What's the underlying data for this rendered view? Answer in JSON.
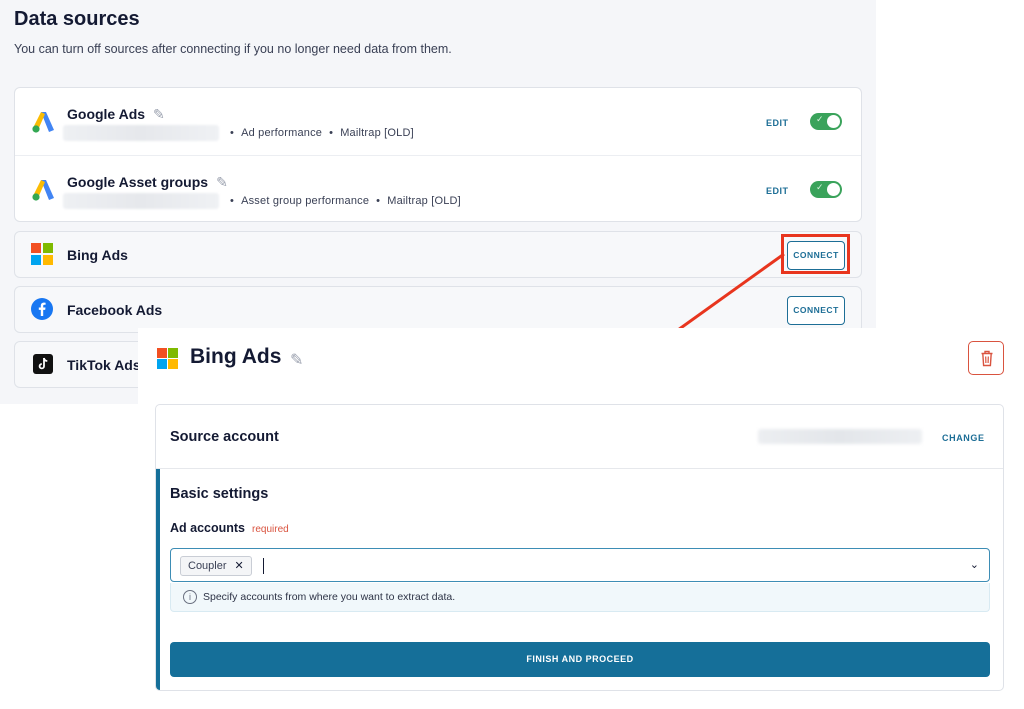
{
  "page": {
    "title": "Data sources",
    "subtitle": "You can turn off sources after connecting if you no longer need data from them."
  },
  "connected_sources": [
    {
      "name": "Google Ads",
      "icon": "google-ads-icon",
      "meta_report": "Ad performance",
      "meta_destination": "Mailtrap [OLD]",
      "edit_label": "EDIT",
      "enabled": true
    },
    {
      "name": "Google Asset groups",
      "icon": "google-ads-icon",
      "meta_report": "Asset group performance",
      "meta_destination": "Mailtrap [OLD]",
      "edit_label": "EDIT",
      "enabled": true
    }
  ],
  "available_sources": [
    {
      "name": "Bing Ads",
      "icon": "microsoft-icon",
      "connect_label": "CONNECT"
    },
    {
      "name": "Facebook Ads",
      "icon": "facebook-icon",
      "connect_label": "CONNECT"
    },
    {
      "name": "TikTok Ads",
      "icon": "tiktok-icon"
    }
  ],
  "detail": {
    "title": "Bing Ads",
    "icon": "microsoft-icon",
    "source_account_label": "Source account",
    "change_label": "CHANGE",
    "basic_settings_label": "Basic settings",
    "ad_accounts_label": "Ad accounts",
    "required_label": "required",
    "selected_chip": "Coupler",
    "hint": "Specify accounts from where you want to extract data.",
    "finish_label": "FINISH AND PROCEED"
  },
  "colors": {
    "accent": "#156f99",
    "toggle_on": "#3aa35b",
    "highlight": "#e8351e",
    "danger": "#d9533f"
  }
}
